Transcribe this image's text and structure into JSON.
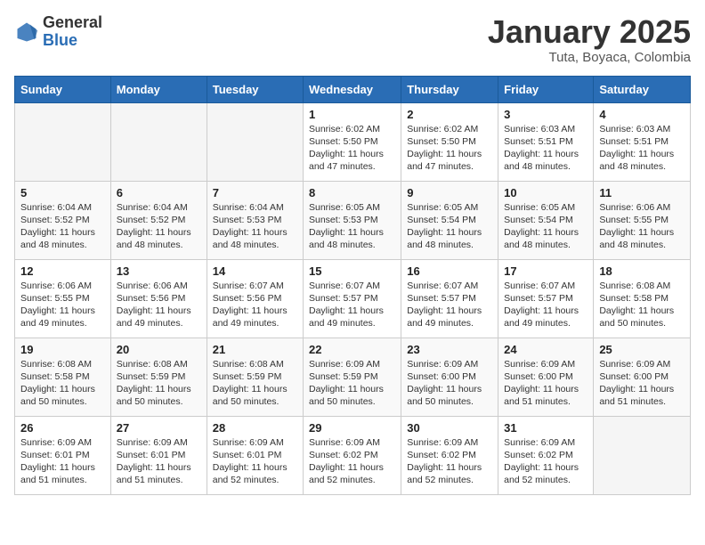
{
  "header": {
    "logo_general": "General",
    "logo_blue": "Blue",
    "title": "January 2025",
    "subtitle": "Tuta, Boyaca, Colombia"
  },
  "weekdays": [
    "Sunday",
    "Monday",
    "Tuesday",
    "Wednesday",
    "Thursday",
    "Friday",
    "Saturday"
  ],
  "weeks": [
    [
      {
        "day": "",
        "info": ""
      },
      {
        "day": "",
        "info": ""
      },
      {
        "day": "",
        "info": ""
      },
      {
        "day": "1",
        "info": "Sunrise: 6:02 AM\nSunset: 5:50 PM\nDaylight: 11 hours and 47 minutes."
      },
      {
        "day": "2",
        "info": "Sunrise: 6:02 AM\nSunset: 5:50 PM\nDaylight: 11 hours and 47 minutes."
      },
      {
        "day": "3",
        "info": "Sunrise: 6:03 AM\nSunset: 5:51 PM\nDaylight: 11 hours and 48 minutes."
      },
      {
        "day": "4",
        "info": "Sunrise: 6:03 AM\nSunset: 5:51 PM\nDaylight: 11 hours and 48 minutes."
      }
    ],
    [
      {
        "day": "5",
        "info": "Sunrise: 6:04 AM\nSunset: 5:52 PM\nDaylight: 11 hours and 48 minutes."
      },
      {
        "day": "6",
        "info": "Sunrise: 6:04 AM\nSunset: 5:52 PM\nDaylight: 11 hours and 48 minutes."
      },
      {
        "day": "7",
        "info": "Sunrise: 6:04 AM\nSunset: 5:53 PM\nDaylight: 11 hours and 48 minutes."
      },
      {
        "day": "8",
        "info": "Sunrise: 6:05 AM\nSunset: 5:53 PM\nDaylight: 11 hours and 48 minutes."
      },
      {
        "day": "9",
        "info": "Sunrise: 6:05 AM\nSunset: 5:54 PM\nDaylight: 11 hours and 48 minutes."
      },
      {
        "day": "10",
        "info": "Sunrise: 6:05 AM\nSunset: 5:54 PM\nDaylight: 11 hours and 48 minutes."
      },
      {
        "day": "11",
        "info": "Sunrise: 6:06 AM\nSunset: 5:55 PM\nDaylight: 11 hours and 48 minutes."
      }
    ],
    [
      {
        "day": "12",
        "info": "Sunrise: 6:06 AM\nSunset: 5:55 PM\nDaylight: 11 hours and 49 minutes."
      },
      {
        "day": "13",
        "info": "Sunrise: 6:06 AM\nSunset: 5:56 PM\nDaylight: 11 hours and 49 minutes."
      },
      {
        "day": "14",
        "info": "Sunrise: 6:07 AM\nSunset: 5:56 PM\nDaylight: 11 hours and 49 minutes."
      },
      {
        "day": "15",
        "info": "Sunrise: 6:07 AM\nSunset: 5:57 PM\nDaylight: 11 hours and 49 minutes."
      },
      {
        "day": "16",
        "info": "Sunrise: 6:07 AM\nSunset: 5:57 PM\nDaylight: 11 hours and 49 minutes."
      },
      {
        "day": "17",
        "info": "Sunrise: 6:07 AM\nSunset: 5:57 PM\nDaylight: 11 hours and 49 minutes."
      },
      {
        "day": "18",
        "info": "Sunrise: 6:08 AM\nSunset: 5:58 PM\nDaylight: 11 hours and 50 minutes."
      }
    ],
    [
      {
        "day": "19",
        "info": "Sunrise: 6:08 AM\nSunset: 5:58 PM\nDaylight: 11 hours and 50 minutes."
      },
      {
        "day": "20",
        "info": "Sunrise: 6:08 AM\nSunset: 5:59 PM\nDaylight: 11 hours and 50 minutes."
      },
      {
        "day": "21",
        "info": "Sunrise: 6:08 AM\nSunset: 5:59 PM\nDaylight: 11 hours and 50 minutes."
      },
      {
        "day": "22",
        "info": "Sunrise: 6:09 AM\nSunset: 5:59 PM\nDaylight: 11 hours and 50 minutes."
      },
      {
        "day": "23",
        "info": "Sunrise: 6:09 AM\nSunset: 6:00 PM\nDaylight: 11 hours and 50 minutes."
      },
      {
        "day": "24",
        "info": "Sunrise: 6:09 AM\nSunset: 6:00 PM\nDaylight: 11 hours and 51 minutes."
      },
      {
        "day": "25",
        "info": "Sunrise: 6:09 AM\nSunset: 6:00 PM\nDaylight: 11 hours and 51 minutes."
      }
    ],
    [
      {
        "day": "26",
        "info": "Sunrise: 6:09 AM\nSunset: 6:01 PM\nDaylight: 11 hours and 51 minutes."
      },
      {
        "day": "27",
        "info": "Sunrise: 6:09 AM\nSunset: 6:01 PM\nDaylight: 11 hours and 51 minutes."
      },
      {
        "day": "28",
        "info": "Sunrise: 6:09 AM\nSunset: 6:01 PM\nDaylight: 11 hours and 52 minutes."
      },
      {
        "day": "29",
        "info": "Sunrise: 6:09 AM\nSunset: 6:02 PM\nDaylight: 11 hours and 52 minutes."
      },
      {
        "day": "30",
        "info": "Sunrise: 6:09 AM\nSunset: 6:02 PM\nDaylight: 11 hours and 52 minutes."
      },
      {
        "day": "31",
        "info": "Sunrise: 6:09 AM\nSunset: 6:02 PM\nDaylight: 11 hours and 52 minutes."
      },
      {
        "day": "",
        "info": ""
      }
    ]
  ]
}
